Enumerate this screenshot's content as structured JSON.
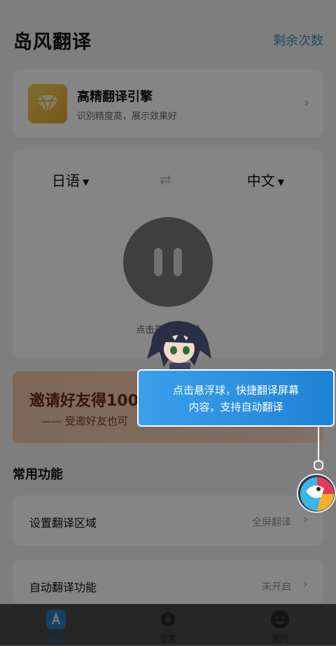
{
  "header": {
    "title": "岛风翻译",
    "remaining_label": "剩余次数"
  },
  "engine": {
    "title": "高精翻译引擎",
    "subtitle": "识别精度高，展示效果好",
    "icon": "diamond-icon"
  },
  "translator": {
    "source_lang": "日语",
    "target_lang": "中文",
    "hint": "点击开启悬浮球"
  },
  "banner": {
    "title": "邀请好友得100",
    "subtitle": "—— 受邀好友也可"
  },
  "common": {
    "title": "常用功能",
    "rows": [
      {
        "label": "设置翻译区域",
        "value": "全屏翻译"
      },
      {
        "label": "自动翻译功能",
        "value": "未开启"
      }
    ]
  },
  "tooltip": {
    "line1": "点击悬浮球，快捷翻译屏幕",
    "line2": "内容，支持自动翻译"
  },
  "tabs": [
    {
      "label": "翻译",
      "icon": "translate-icon"
    },
    {
      "label": "设置",
      "icon": "gear-icon"
    },
    {
      "label": "我的",
      "icon": "profile-icon"
    }
  ],
  "colors": {
    "accent": "#3d8fc4",
    "tooltip": "#2a92e0",
    "background": "#f2f2f2"
  }
}
